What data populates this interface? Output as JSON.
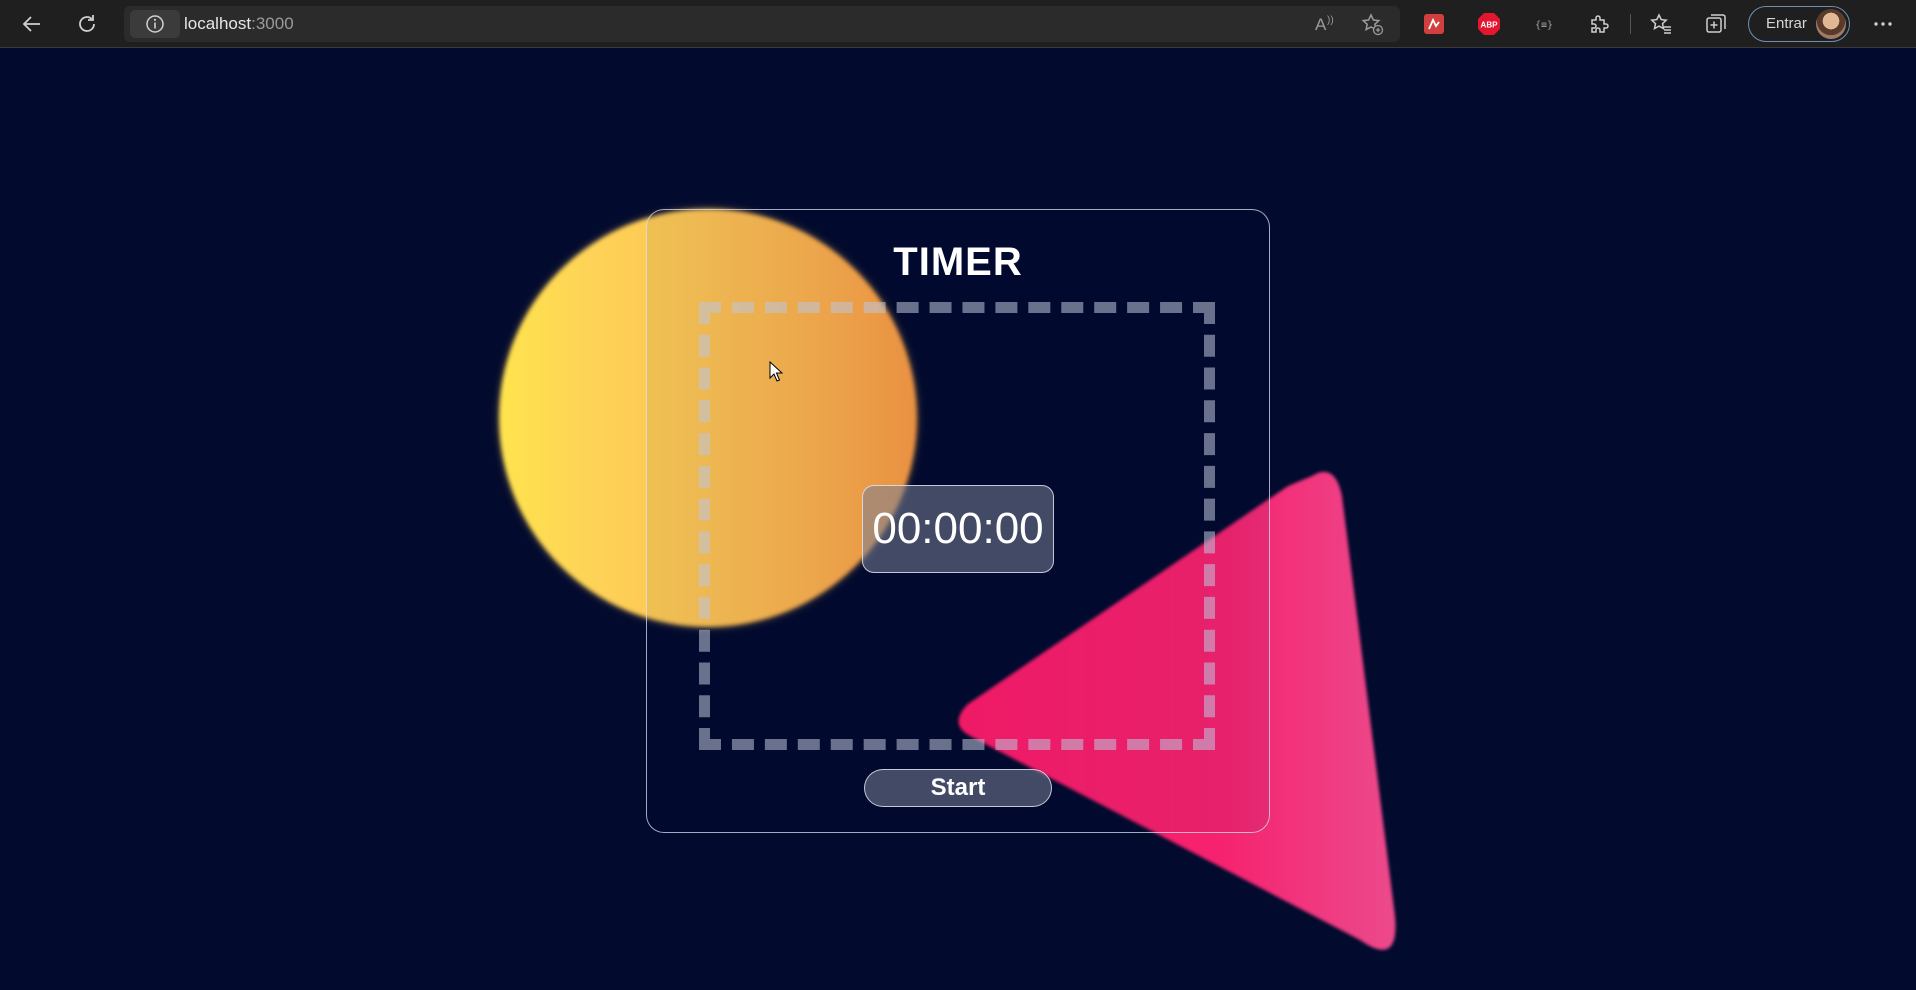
{
  "browser": {
    "url_host": "localhost",
    "url_port": ":3000",
    "signin_label": "Entrar",
    "extensions": [
      {
        "name": "clipper-extension-icon",
        "color": "#d23f3f"
      },
      {
        "name": "adblock-plus-icon",
        "label": "ABP",
        "color": "#e3162f"
      },
      {
        "name": "json-viewer-icon",
        "label": "{≡}"
      }
    ]
  },
  "timer": {
    "title": "TIMER",
    "display": "00:00:00",
    "start_label": "Start"
  },
  "colors": {
    "background": "#020a2e",
    "circle_light": "#ffe44d",
    "circle_dark": "#f99a43",
    "triangle": "#ff1f6e"
  }
}
